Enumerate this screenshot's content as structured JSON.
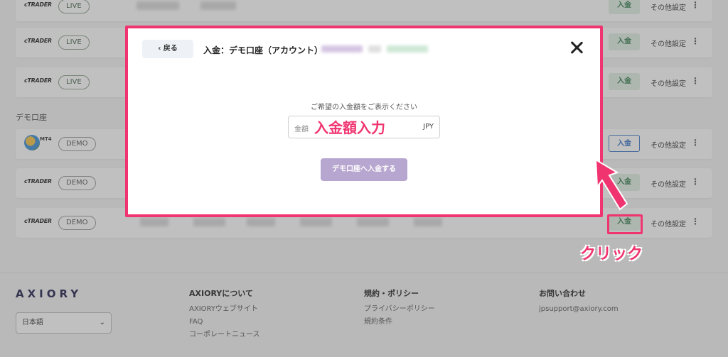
{
  "accounts": [
    {
      "type": "ctrader",
      "badge": "LIVE",
      "deposit": "入金",
      "other": "その他設定",
      "more": "⋮"
    },
    {
      "type": "ctrader",
      "badge": "LIVE",
      "deposit": "入金",
      "other": "その他設定",
      "more": "⋮"
    },
    {
      "type": "ctrader",
      "badge": "LIVE",
      "deposit": "入金",
      "other": "その他設定",
      "more": "⋮"
    },
    {
      "type": "mt4",
      "badge": "DEMO",
      "deposit": "入金",
      "other": "その他設定",
      "more": "⋮"
    },
    {
      "type": "ctrader",
      "badge": "DEMO",
      "deposit": "入金",
      "other": "その他設定",
      "more": "⋮"
    },
    {
      "type": "ctrader",
      "badge": "DEMO",
      "deposit": "入金",
      "other": "その他設定",
      "more": "⋮"
    }
  ],
  "brand_ctrader": "cTRADER",
  "brand_mt4": "MT4",
  "section_demo": "デモ口座",
  "modal": {
    "back": "‹  戻る",
    "title": "入金：デモ口座（アカウント）",
    "prompt": "ご希望の入金額をご表示ください",
    "amount_placeholder": "金額",
    "amount_unit": "JPY",
    "amount_note": "入金額入力",
    "submit": "デモ口座へ入金する"
  },
  "annotation": {
    "click": "クリック",
    "color": "#f0346f"
  },
  "footer": {
    "logo": "AXIORY",
    "language": "日本語",
    "col1": {
      "heading": "AXIORYについて",
      "links": [
        "AXIORYウェブサイト",
        "FAQ",
        "コーポレートニュース"
      ]
    },
    "col2": {
      "heading": "規約・ポリシー",
      "links": [
        "プライバシーポリシー",
        "規約条件"
      ]
    },
    "col3": {
      "heading": "お問い合わせ",
      "links": [
        "jpsupport@axiory.com"
      ]
    }
  }
}
